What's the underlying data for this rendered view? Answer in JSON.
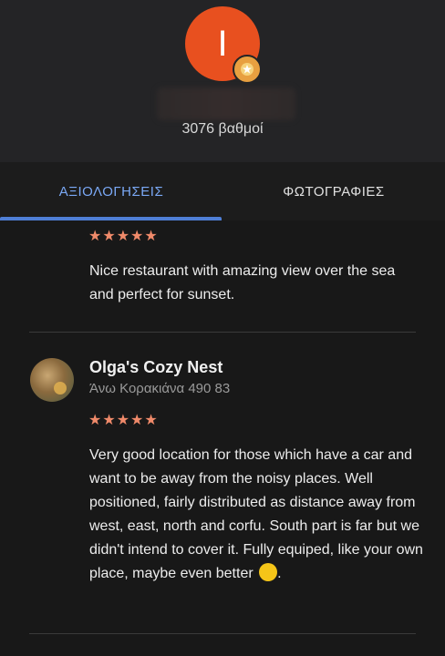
{
  "profile": {
    "avatar_letter": "I",
    "points": "3076 βαθμοί"
  },
  "tabs": [
    {
      "label": "ΑΞΙΟΛΟΓΗΣΕΙΣ",
      "active": true
    },
    {
      "label": "ΦΩΤΟΓΡΑΦΙΕΣ",
      "active": false
    }
  ],
  "colors": {
    "accent": "#4f7fd6",
    "active_tab_text": "#7aa8f5",
    "avatar_bg": "#e8501f",
    "stars": "#f08a6a"
  },
  "reviews": [
    {
      "stars": "★★★★★",
      "rating": 5,
      "text": "Nice restaurant with amazing view over the sea and perfect for sunset."
    },
    {
      "name": "Olga's Cozy Nest",
      "location": "Άνω Κορακιάνα 490 83",
      "stars": "★★★★★",
      "rating": 5,
      "text": "Very good location for those which have a car and want to be away from the noisy places. Well positioned, fairly distributed as distance away from west, east, north and corfu. South part is far but we didn't intend to cover it. Fully equiped, like your own place, maybe even better",
      "emoji": "rolling-on-floor-laughing-emoji"
    }
  ]
}
